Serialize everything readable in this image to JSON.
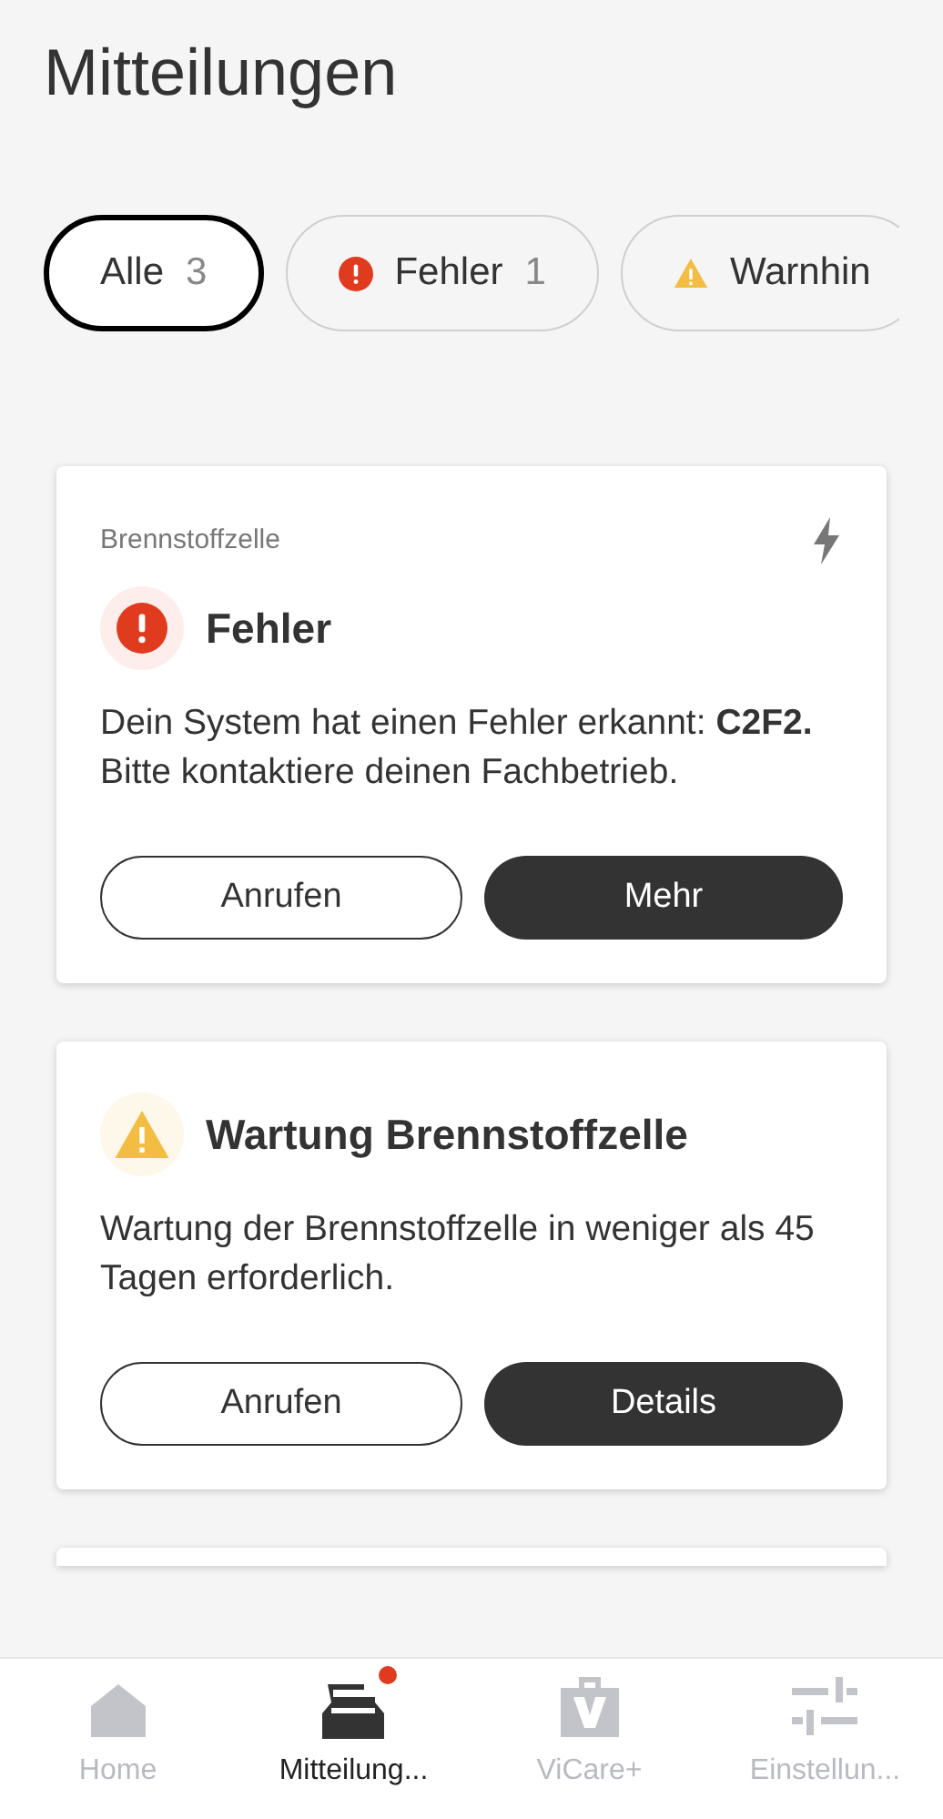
{
  "title": "Mitteilungen",
  "filters": [
    {
      "label": "Alle",
      "count": "3",
      "selected": true,
      "kind": "all"
    },
    {
      "label": "Fehler",
      "count": "1",
      "selected": false,
      "kind": "error"
    },
    {
      "label": "Warnhin",
      "selected": false,
      "kind": "warning"
    }
  ],
  "messages": [
    {
      "kind": "error",
      "category": "Brennstoffzelle",
      "title": "Fehler",
      "text": "Dein System hat einen Fehler erkannt: **C2F2.** Bitte kontaktiere deinen Fachbetrieb.",
      "buttons": [
        "Anrufen",
        "Mehr"
      ]
    },
    {
      "kind": "warning",
      "title": "Wartung Brennstoffzelle",
      "text": "Wartung der Brennstoffzelle in weniger als 45 Tagen erforderlich.",
      "buttons": [
        "Anrufen",
        "Details"
      ]
    }
  ],
  "nav": [
    {
      "label": "Home",
      "kind": "home",
      "selected": false,
      "badge": false
    },
    {
      "label": "Mitteilung...",
      "kind": "messages",
      "selected": true,
      "badge": true
    },
    {
      "label": "ViCare+",
      "kind": "vicare",
      "selected": false,
      "badge": false
    },
    {
      "label": "Einstellun...",
      "kind": "settings",
      "selected": false,
      "badge": false
    }
  ]
}
